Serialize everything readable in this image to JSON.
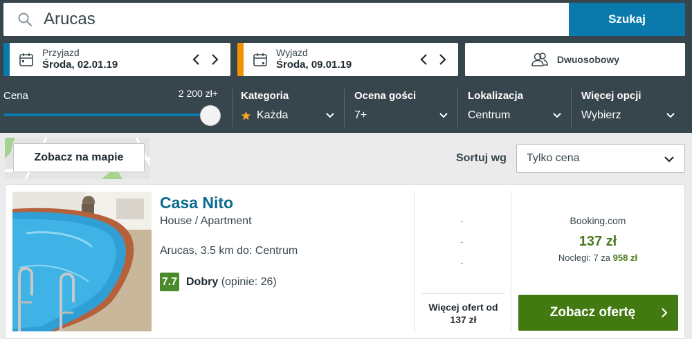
{
  "search": {
    "query": "Arucas",
    "button": "Szukaj"
  },
  "checkin": {
    "label": "Przyjazd",
    "value": "Środa, 02.01.19"
  },
  "checkout": {
    "label": "Wyjazd",
    "value": "Środa, 09.01.19"
  },
  "room": {
    "label": "Dwuosobowy"
  },
  "filters": {
    "price": {
      "label": "Cena",
      "value": "2 200 zł+",
      "level_percent": 100
    },
    "category": {
      "label": "Kategoria",
      "value": "Każda"
    },
    "rating": {
      "label": "Ocena gości",
      "value": "7+"
    },
    "location": {
      "label": "Lokalizacja",
      "value": "Centrum"
    },
    "more": {
      "label": "Więcej opcji",
      "value": "Wybierz"
    }
  },
  "map_button": "Zobacz na mapie",
  "sort": {
    "label": "Sortuj wg",
    "value": "Tylko cena"
  },
  "result": {
    "name": "Casa Nito",
    "type": "House / Apartment",
    "location": "Arucas, 3.5 km do: Centrum",
    "score": "7.7",
    "rating_word": "Dobry",
    "rating_count": "(opinie: 26)",
    "dashes": [
      "-",
      "-",
      "-"
    ],
    "more_offers_line1": "Więcej ofert od",
    "more_offers_line2": "137 zł",
    "provider": "Booking.com",
    "price": "137 zł",
    "nights_text": "Noclegi: 7 za",
    "nights_total": "958 zł",
    "cta": "Zobacz ofertę"
  },
  "colors": {
    "header_bg": "#37454d",
    "accent_blue": "#0a7aad",
    "checkin_stripe": "#0a7aad",
    "checkout_stripe": "#f39200",
    "cta_green": "#427a11",
    "price_green": "#4a7a1e",
    "star": "#f5a623"
  }
}
